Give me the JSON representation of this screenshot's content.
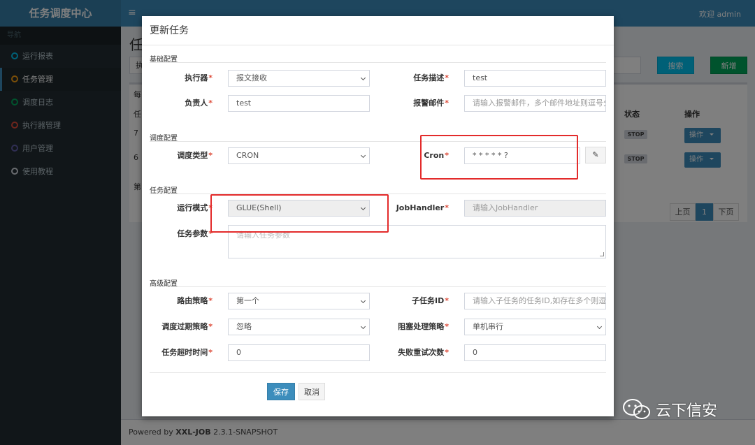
{
  "app": {
    "logo": "任务调度中心",
    "user_greeting": "欢迎 admin"
  },
  "sidebar": {
    "header": "导航",
    "items": [
      {
        "label": "运行报表",
        "color": "#00c0ef"
      },
      {
        "label": "任务管理",
        "color": "#f39c12"
      },
      {
        "label": "调度日志",
        "color": "#00a65a"
      },
      {
        "label": "执行器管理",
        "color": "#dd4b39"
      },
      {
        "label": "用户管理",
        "color": "#605ca8"
      },
      {
        "label": "使用教程",
        "color": "#d2d6de"
      }
    ]
  },
  "background": {
    "page_title": "任",
    "search_fragment": "执",
    "search_label": "搜索",
    "add_label": "新增",
    "box_fragments": [
      "每",
      "任",
      "7",
      "6",
      "第"
    ],
    "col_status": "状态",
    "col_ops": "操作",
    "rows": [
      {
        "status": "STOP",
        "op": "操作"
      },
      {
        "status": "STOP",
        "op": "操作"
      }
    ],
    "pager": {
      "prev": "上页",
      "current": "1",
      "next": "下页"
    },
    "footer": {
      "prefix": "Powered by ",
      "brand": "XXL-JOB",
      "version": " 2.3.1-SNAPSHOT"
    }
  },
  "modal": {
    "title": "更新任务",
    "sections": {
      "basic": "基础配置",
      "schedule": "调度配置",
      "task": "任务配置",
      "advanced": "高级配置"
    },
    "fields": {
      "executor": {
        "label": "执行器",
        "value": "报文接收"
      },
      "desc": {
        "label": "任务描述",
        "value": "test"
      },
      "owner": {
        "label": "负责人",
        "value": "test"
      },
      "alarm": {
        "label": "报警邮件",
        "placeholder": "请输入报警邮件，多个邮件地址则逗号分隔"
      },
      "sched_type": {
        "label": "调度类型",
        "value": "CRON"
      },
      "cron": {
        "label": "Cron",
        "value": "* * * * * ?"
      },
      "run_mode": {
        "label": "运行模式",
        "value": "GLUE(Shell)"
      },
      "job_handler": {
        "label": "JobHandler",
        "placeholder": "请输入JobHandler"
      },
      "params": {
        "label": "任务参数",
        "placeholder": "请输入任务参数"
      },
      "route": {
        "label": "路由策略",
        "value": "第一个"
      },
      "child_id": {
        "label": "子任务ID",
        "placeholder": "请输入子任务的任务ID,如存在多个则逗号分隔"
      },
      "misfire": {
        "label": "调度过期策略",
        "value": "忽略"
      },
      "block": {
        "label": "阻塞处理策略",
        "value": "单机串行"
      },
      "timeout": {
        "label": "任务超时时间",
        "value": "0"
      },
      "retry": {
        "label": "失败重试次数",
        "value": "0"
      }
    },
    "required_mark": "*",
    "save_label": "保存",
    "cancel_label": "取消"
  },
  "watermark": {
    "text": "云下信安"
  },
  "colors": {
    "primary": "#3c8dbc",
    "sidebar": "#222d32",
    "highlight": "#e32b2b",
    "required": "#dd4b39"
  }
}
